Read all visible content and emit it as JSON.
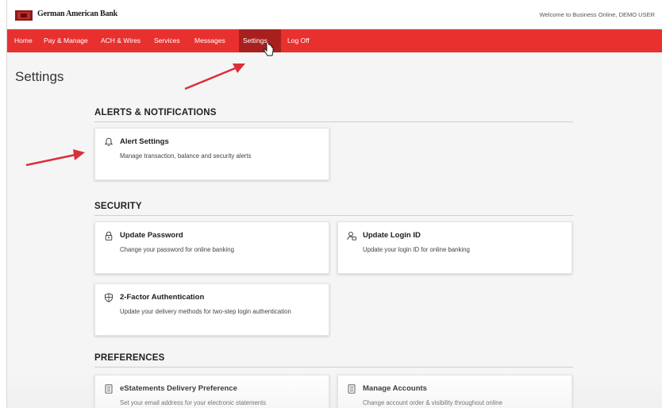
{
  "header": {
    "bank_name": "German American Bank",
    "welcome_text": "Welcome to Business Online, DEMO USER",
    "logo_icon": "bank-logo-icon"
  },
  "nav": {
    "items": [
      {
        "label": "Home"
      },
      {
        "label": "Pay & Manage"
      },
      {
        "label": "ACH & Wires"
      },
      {
        "label": "Services"
      },
      {
        "label": "Messages"
      },
      {
        "label": "Settings"
      },
      {
        "label": "Log Off"
      }
    ],
    "active": "Settings"
  },
  "page": {
    "title": "Settings"
  },
  "sections": {
    "alerts": {
      "title": "ALERTS & NOTIFICATIONS",
      "cards": [
        {
          "title": "Alert Settings",
          "desc": "Manage transaction, balance and security alerts",
          "icon": "bell-icon"
        }
      ]
    },
    "security": {
      "title": "SECURITY",
      "cards": [
        {
          "title": "Update Password",
          "desc": "Change your password for online banking",
          "icon": "lock-icon"
        },
        {
          "title": "Update Login ID",
          "desc": "Update your login ID for online banking",
          "icon": "user-id-icon"
        },
        {
          "title": "2-Factor Authentication",
          "desc": "Update your delivery methods for two-step login authentication",
          "icon": "shield-icon"
        }
      ]
    },
    "preferences": {
      "title": "PREFERENCES",
      "cards": [
        {
          "title": "eStatements Delivery Preference",
          "desc": "Set your email address for your electronic statements",
          "icon": "document-icon"
        },
        {
          "title": "Manage Accounts",
          "desc": "Change account order & visibility throughout online",
          "icon": "document-icon"
        }
      ]
    }
  },
  "colors": {
    "brand_red": "#e8312f",
    "active_tab": "#a8201e",
    "annotation_arrow": "#d9303a"
  }
}
